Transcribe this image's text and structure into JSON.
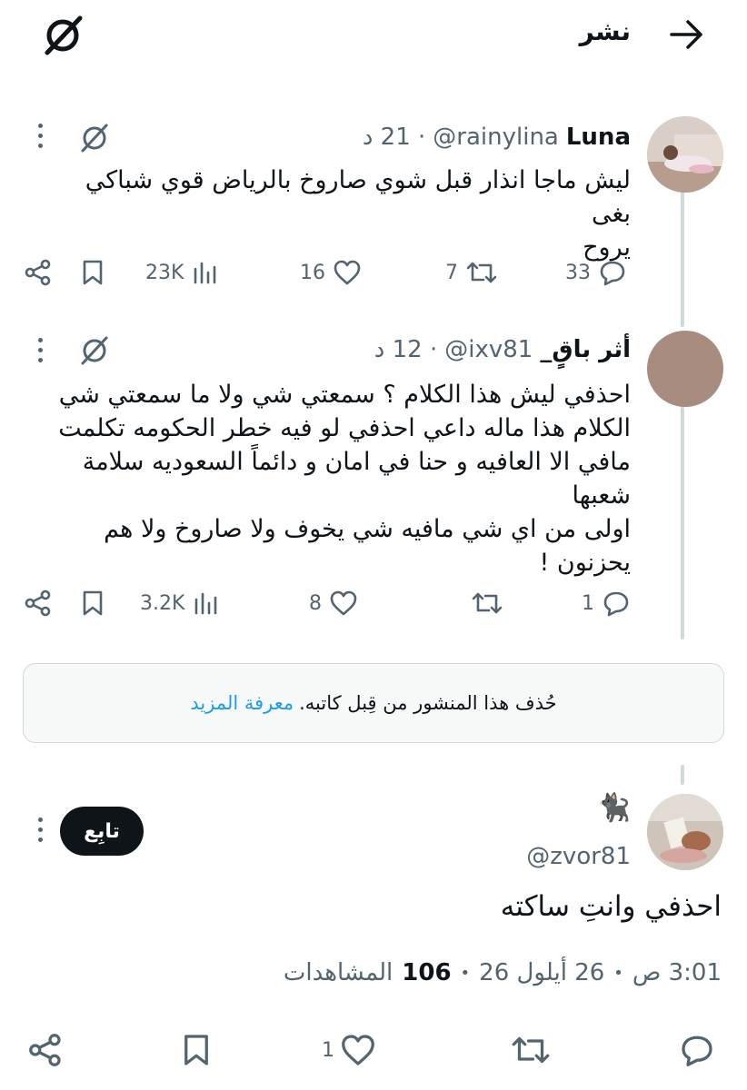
{
  "header": {
    "title": "نشر",
    "back_icon": "arrow-right-icon",
    "app_icon": "slashed-circle-icon"
  },
  "tweets": [
    {
      "name": "Luna",
      "handle": "@rainylina",
      "time": "· 21 د",
      "text_lines": [
        "ليش ماجا انذار قبل شوي صاروخ بالرياض قوي شباكي بغى",
        "يروح"
      ],
      "replies": "33",
      "retweets": "7",
      "likes": "16",
      "views": "23K"
    },
    {
      "name": "أثر باقٍ_",
      "handle": "@ixv81",
      "time": "· 12 د",
      "text_lines": [
        "احذفي ليش هذا الكلام ؟ سمعتي شي ولا ما سمعتي شي",
        "الكلام هذا ماله داعي احذفي لو فيه خطر الحكومه تكلمت",
        "مافي الا العافيه و حنا في امان و دائماً السعوديه سلامة شعبها",
        "اولى من اي شي مافيه شي يخوف ولا صاروخ ولا هم",
        "يحزنون !"
      ],
      "replies": "1",
      "retweets": "",
      "likes": "8",
      "views": "3.2K"
    }
  ],
  "notice": {
    "text": "حُذف هذا المنشور من قِبل كاتبه.",
    "link": "معرفة المزيد"
  },
  "main_tweet": {
    "name_emoji": "🐈‍⬛",
    "handle": "@zvor81",
    "follow_label": "تابِع",
    "text": "احذفي وانتِ ساكته",
    "time": "3:01 ص",
    "date": "26 أيلول 26",
    "views_count": "106",
    "views_label": "المشاهدات",
    "sep": "•",
    "likes": "1"
  },
  "colors": {
    "text": "#0f1419",
    "muted": "#536471",
    "link": "#1d9bf0",
    "line": "#cfd9de"
  }
}
